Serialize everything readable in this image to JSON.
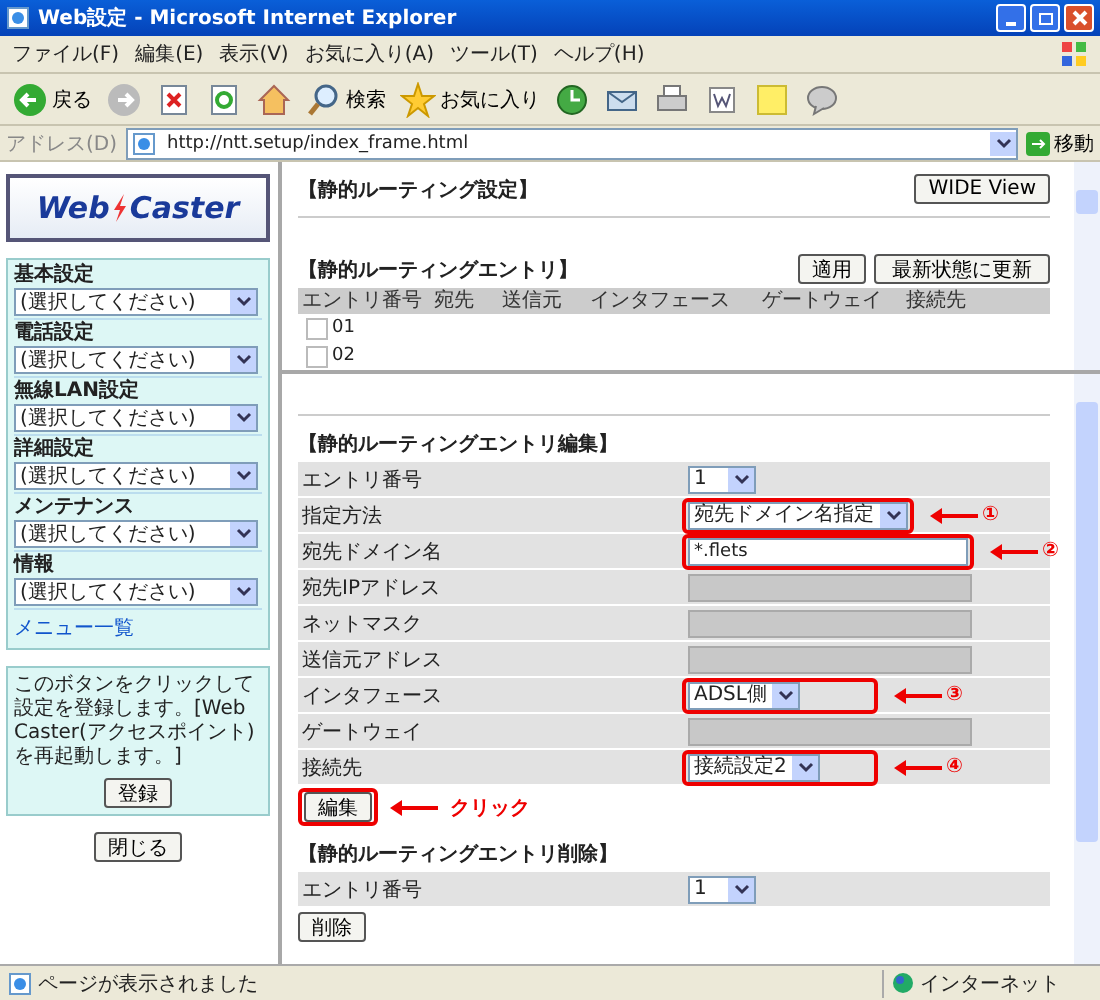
{
  "window": {
    "title": "Web設定 - Microsoft Internet Explorer"
  },
  "menu": [
    "ファイル(F)",
    "編集(E)",
    "表示(V)",
    "お気に入り(A)",
    "ツール(T)",
    "ヘルプ(H)"
  ],
  "toolbar": [
    {
      "kind": "back",
      "label": "戻る"
    },
    {
      "kind": "forward"
    },
    {
      "kind": "stop"
    },
    {
      "kind": "refresh"
    },
    {
      "kind": "home"
    },
    {
      "kind": "search",
      "label": "検索"
    },
    {
      "kind": "favorites",
      "label": "お気に入り"
    },
    {
      "kind": "history"
    },
    {
      "kind": "mail"
    },
    {
      "kind": "print"
    },
    {
      "kind": "edit"
    },
    {
      "kind": "note"
    },
    {
      "kind": "messenger"
    }
  ],
  "address": {
    "label": "アドレス(D)",
    "value": "http://ntt.setup/index_frame.html",
    "go": "移動"
  },
  "sidebar": {
    "logo": [
      "Web",
      "Caster"
    ],
    "groups": [
      {
        "label": "基本設定",
        "value": "(選択してください)"
      },
      {
        "label": "電話設定",
        "value": "(選択してください)"
      },
      {
        "label": "無線LAN設定",
        "value": "(選択してください)"
      },
      {
        "label": "詳細設定",
        "value": "(選択してください)"
      },
      {
        "label": "メンテナンス",
        "value": "(選択してください)"
      },
      {
        "label": "情報",
        "value": "(選択してください)"
      }
    ],
    "link": "メニュー一覧",
    "note": "このボタンをクリックして設定を登録します。[Web Caster(アクセスポイント)を再起動します。]",
    "register": "登録",
    "close": "閉じる"
  },
  "top": {
    "title": "【静的ルーティング設定】",
    "wide": "WIDE View",
    "section": "【静的ルーティングエントリ】",
    "buttons": [
      "適用",
      "最新状態に更新"
    ],
    "columns": [
      "エントリ番号",
      "宛先",
      "送信元",
      "インタフェース",
      "ゲートウェイ",
      "接続先"
    ],
    "rows": [
      {
        "number": "01",
        "checked": false
      },
      {
        "number": "02",
        "checked": false
      }
    ]
  },
  "edit": {
    "title": "【静的ルーティングエントリ編集】",
    "rows": [
      {
        "label": "エントリ番号",
        "kind": "select",
        "value": "1",
        "highlighted": false
      },
      {
        "label": "指定方法",
        "kind": "select",
        "value": "宛先ドメイン名指定",
        "highlighted": true,
        "callout": "①"
      },
      {
        "label": "宛先ドメイン名",
        "kind": "text",
        "value": "*.flets",
        "highlighted": true,
        "callout": "②"
      },
      {
        "label": "宛先IPアドレス",
        "kind": "disabled",
        "highlighted": false
      },
      {
        "label": "ネットマスク",
        "kind": "disabled",
        "highlighted": false
      },
      {
        "label": "送信元アドレス",
        "kind": "disabled",
        "highlighted": false
      },
      {
        "label": "インタフェース",
        "kind": "select",
        "value": "ADSL側",
        "highlighted": true,
        "callout": "③"
      },
      {
        "label": "ゲートウェイ",
        "kind": "disabled",
        "highlighted": false
      },
      {
        "label": "接続先",
        "kind": "select",
        "value": "接続設定2",
        "highlighted": true,
        "callout": "④"
      }
    ],
    "button": "編集",
    "button_callout": "クリック"
  },
  "delete": {
    "title": "【静的ルーティングエントリ削除】",
    "rows": [
      {
        "label": "エントリ番号",
        "kind": "select",
        "value": "1",
        "highlighted": false
      }
    ],
    "button": "削除"
  },
  "status": {
    "text": "ページが表示されました",
    "zone": "インターネット"
  }
}
